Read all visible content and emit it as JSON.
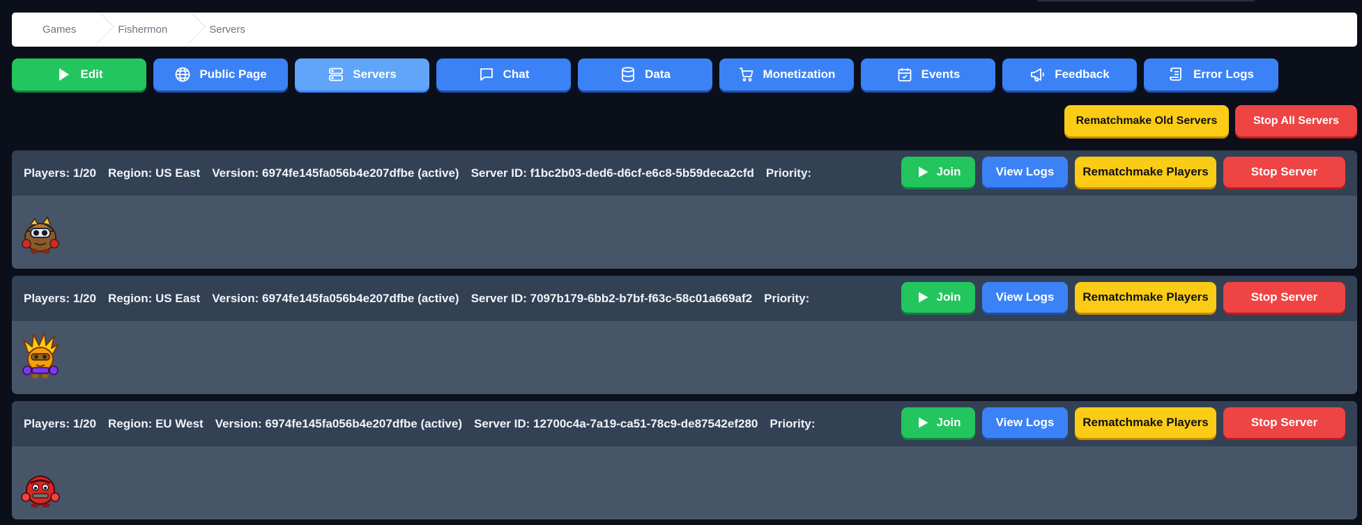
{
  "breadcrumb": [
    "Games",
    "Fishermon",
    "Servers"
  ],
  "nav": [
    {
      "label": "Edit",
      "icon": "play-icon"
    },
    {
      "label": "Public Page",
      "icon": "globe-icon"
    },
    {
      "label": "Servers",
      "icon": "server-icon"
    },
    {
      "label": "Chat",
      "icon": "chat-icon"
    },
    {
      "label": "Data",
      "icon": "database-icon"
    },
    {
      "label": "Monetization",
      "icon": "cart-icon"
    },
    {
      "label": "Events",
      "icon": "calendar-icon"
    },
    {
      "label": "Feedback",
      "icon": "megaphone-icon"
    },
    {
      "label": "Error Logs",
      "icon": "scroll-icon"
    }
  ],
  "active_tab": "Servers",
  "global_actions": {
    "rematchmake_old": "Rematchmake Old Servers",
    "stop_all": "Stop All Servers"
  },
  "server_labels": {
    "join": "Join",
    "view_logs": "View Logs",
    "rematchmake": "Rematchmake Players",
    "stop": "Stop Server"
  },
  "servers": [
    {
      "players": "Players: 1/20",
      "region": "Region: US East",
      "version": "Version: 6974fe145fa056b4e207dfbe (active)",
      "server_id": "Server ID: f1bc2b03-ded6-d6cf-e6c8-5b59deca2cfd",
      "priority": "Priority:",
      "avatar": "brown-helmet-creature-avatar"
    },
    {
      "players": "Players: 1/20",
      "region": "Region: US East",
      "version": "Version: 6974fe145fa056b4e207dfbe (active)",
      "server_id": "Server ID: 7097b179-6bb2-b7bf-f63c-58c01a669af2",
      "priority": "Priority:",
      "avatar": "yellow-spiky-creature-avatar"
    },
    {
      "players": "Players: 1/20",
      "region": "Region: EU West",
      "version": "Version: 6974fe145fa056b4e207dfbe (active)",
      "server_id": "Server ID: 12700c4a-7a19-ca51-78c9-de87542ef280",
      "priority": "Priority:",
      "avatar": "red-blob-creature-avatar"
    }
  ],
  "colors": {
    "background": "#0a0f1a",
    "primary": "#3b82f6",
    "active": "#60a5fa",
    "success": "#22c55e",
    "warning": "#facc15",
    "danger": "#ef4444",
    "card": "#475569",
    "card_header": "#334155"
  }
}
